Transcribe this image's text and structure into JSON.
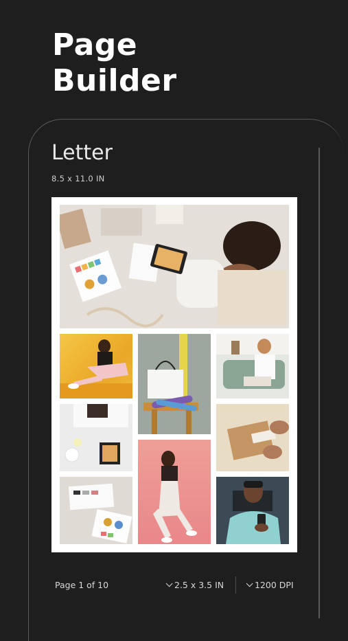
{
  "header": {
    "title_line1": "Page",
    "title_line2": "Builder"
  },
  "document": {
    "name": "Letter",
    "size": "8.5 x 11.0 IN"
  },
  "footer": {
    "page_indicator": "Page 1 of 10",
    "photo_size": "2.5 x 3.5 IN",
    "resolution": "1200 DPI"
  },
  "icons": {
    "dropdown": "chevron-down-icon"
  }
}
